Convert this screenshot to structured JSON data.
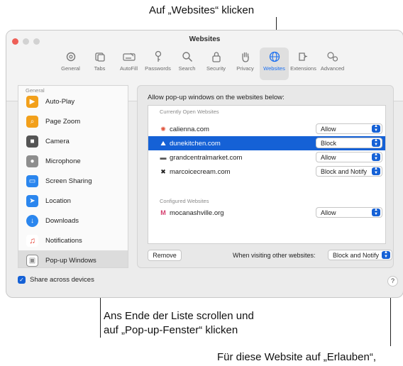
{
  "callouts": {
    "top": "Auf „Websites“ klicken",
    "middle_line1": "Ans Ende der Liste scrollen und",
    "middle_line2": "auf „Pop-up-Fenster“ klicken",
    "bottom": "Für diese Website auf „Erlauben“,"
  },
  "window": {
    "title": "Websites"
  },
  "toolbar": [
    {
      "label": "General",
      "icon": "gear-icon"
    },
    {
      "label": "Tabs",
      "icon": "tabs-icon"
    },
    {
      "label": "AutoFill",
      "icon": "autofill-icon"
    },
    {
      "label": "Passwords",
      "icon": "key-icon"
    },
    {
      "label": "Search",
      "icon": "search-icon"
    },
    {
      "label": "Security",
      "icon": "lock-icon"
    },
    {
      "label": "Privacy",
      "icon": "hand-icon"
    },
    {
      "label": "Websites",
      "icon": "globe-icon",
      "active": true
    },
    {
      "label": "Extensions",
      "icon": "puzzle-icon"
    },
    {
      "label": "Advanced",
      "icon": "advanced-gears-icon"
    }
  ],
  "sidebar": {
    "heading": "General",
    "items": [
      {
        "label": "Auto-Play",
        "icon": "play-icon",
        "color": "#f2a01b"
      },
      {
        "label": "Page Zoom",
        "icon": "zoom-icon",
        "color": "#f2a01b"
      },
      {
        "label": "Camera",
        "icon": "camera-icon",
        "color": "#555555"
      },
      {
        "label": "Microphone",
        "icon": "microphone-icon",
        "color": "#8e8e8e"
      },
      {
        "label": "Screen Sharing",
        "icon": "screen-sharing-icon",
        "color": "#2b86ee"
      },
      {
        "label": "Location",
        "icon": "location-icon",
        "color": "#2b86ee"
      },
      {
        "label": "Downloads",
        "icon": "download-icon",
        "color": "#2b86ee"
      },
      {
        "label": "Notifications",
        "icon": "notification-icon",
        "color": "#e6483d"
      },
      {
        "label": "Pop-up Windows",
        "icon": "popup-window-icon",
        "color": "#8e8e8e",
        "selected": true
      }
    ]
  },
  "panel": {
    "heading": "Allow pop-up windows on the websites below:",
    "open_heading": "Currently Open Websites",
    "configured_heading": "Configured Websites",
    "open_sites": [
      {
        "site": "calienna.com",
        "setting": "Allow",
        "icon": "sun-logo-icon"
      },
      {
        "site": "dunekitchen.com",
        "setting": "Block",
        "icon": "dune-logo-icon",
        "selected": true
      },
      {
        "site": "grandcentralmarket.com",
        "setting": "Allow",
        "icon": "market-logo-icon"
      },
      {
        "site": "marcoicecream.com",
        "setting": "Block and Notify",
        "icon": "icecream-logo-icon"
      }
    ],
    "configured_sites": [
      {
        "site": "mocanashville.org",
        "setting": "Allow",
        "icon": "moca-logo-icon"
      }
    ],
    "remove_label": "Remove",
    "other_label": "When visiting other websites:",
    "other_value": "Block and Notify"
  },
  "footer": {
    "share_label": "Share across devices",
    "help_label": "?"
  },
  "colors": {
    "accent": "#1561d6",
    "selected_row": "#1561d6"
  }
}
